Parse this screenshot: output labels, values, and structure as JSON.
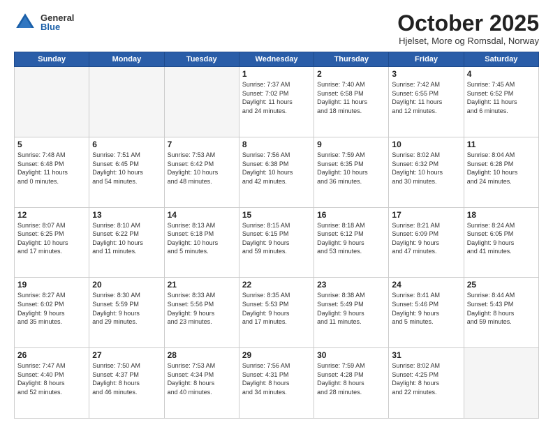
{
  "logo": {
    "general": "General",
    "blue": "Blue"
  },
  "title": "October 2025",
  "location": "Hjelset, More og Romsdal, Norway",
  "days_of_week": [
    "Sunday",
    "Monday",
    "Tuesday",
    "Wednesday",
    "Thursday",
    "Friday",
    "Saturday"
  ],
  "weeks": [
    [
      {
        "day": "",
        "info": ""
      },
      {
        "day": "",
        "info": ""
      },
      {
        "day": "",
        "info": ""
      },
      {
        "day": "1",
        "info": "Sunrise: 7:37 AM\nSunset: 7:02 PM\nDaylight: 11 hours\nand 24 minutes."
      },
      {
        "day": "2",
        "info": "Sunrise: 7:40 AM\nSunset: 6:58 PM\nDaylight: 11 hours\nand 18 minutes."
      },
      {
        "day": "3",
        "info": "Sunrise: 7:42 AM\nSunset: 6:55 PM\nDaylight: 11 hours\nand 12 minutes."
      },
      {
        "day": "4",
        "info": "Sunrise: 7:45 AM\nSunset: 6:52 PM\nDaylight: 11 hours\nand 6 minutes."
      }
    ],
    [
      {
        "day": "5",
        "info": "Sunrise: 7:48 AM\nSunset: 6:48 PM\nDaylight: 11 hours\nand 0 minutes."
      },
      {
        "day": "6",
        "info": "Sunrise: 7:51 AM\nSunset: 6:45 PM\nDaylight: 10 hours\nand 54 minutes."
      },
      {
        "day": "7",
        "info": "Sunrise: 7:53 AM\nSunset: 6:42 PM\nDaylight: 10 hours\nand 48 minutes."
      },
      {
        "day": "8",
        "info": "Sunrise: 7:56 AM\nSunset: 6:38 PM\nDaylight: 10 hours\nand 42 minutes."
      },
      {
        "day": "9",
        "info": "Sunrise: 7:59 AM\nSunset: 6:35 PM\nDaylight: 10 hours\nand 36 minutes."
      },
      {
        "day": "10",
        "info": "Sunrise: 8:02 AM\nSunset: 6:32 PM\nDaylight: 10 hours\nand 30 minutes."
      },
      {
        "day": "11",
        "info": "Sunrise: 8:04 AM\nSunset: 6:28 PM\nDaylight: 10 hours\nand 24 minutes."
      }
    ],
    [
      {
        "day": "12",
        "info": "Sunrise: 8:07 AM\nSunset: 6:25 PM\nDaylight: 10 hours\nand 17 minutes."
      },
      {
        "day": "13",
        "info": "Sunrise: 8:10 AM\nSunset: 6:22 PM\nDaylight: 10 hours\nand 11 minutes."
      },
      {
        "day": "14",
        "info": "Sunrise: 8:13 AM\nSunset: 6:18 PM\nDaylight: 10 hours\nand 5 minutes."
      },
      {
        "day": "15",
        "info": "Sunrise: 8:15 AM\nSunset: 6:15 PM\nDaylight: 9 hours\nand 59 minutes."
      },
      {
        "day": "16",
        "info": "Sunrise: 8:18 AM\nSunset: 6:12 PM\nDaylight: 9 hours\nand 53 minutes."
      },
      {
        "day": "17",
        "info": "Sunrise: 8:21 AM\nSunset: 6:09 PM\nDaylight: 9 hours\nand 47 minutes."
      },
      {
        "day": "18",
        "info": "Sunrise: 8:24 AM\nSunset: 6:05 PM\nDaylight: 9 hours\nand 41 minutes."
      }
    ],
    [
      {
        "day": "19",
        "info": "Sunrise: 8:27 AM\nSunset: 6:02 PM\nDaylight: 9 hours\nand 35 minutes."
      },
      {
        "day": "20",
        "info": "Sunrise: 8:30 AM\nSunset: 5:59 PM\nDaylight: 9 hours\nand 29 minutes."
      },
      {
        "day": "21",
        "info": "Sunrise: 8:33 AM\nSunset: 5:56 PM\nDaylight: 9 hours\nand 23 minutes."
      },
      {
        "day": "22",
        "info": "Sunrise: 8:35 AM\nSunset: 5:53 PM\nDaylight: 9 hours\nand 17 minutes."
      },
      {
        "day": "23",
        "info": "Sunrise: 8:38 AM\nSunset: 5:49 PM\nDaylight: 9 hours\nand 11 minutes."
      },
      {
        "day": "24",
        "info": "Sunrise: 8:41 AM\nSunset: 5:46 PM\nDaylight: 9 hours\nand 5 minutes."
      },
      {
        "day": "25",
        "info": "Sunrise: 8:44 AM\nSunset: 5:43 PM\nDaylight: 8 hours\nand 59 minutes."
      }
    ],
    [
      {
        "day": "26",
        "info": "Sunrise: 7:47 AM\nSunset: 4:40 PM\nDaylight: 8 hours\nand 52 minutes."
      },
      {
        "day": "27",
        "info": "Sunrise: 7:50 AM\nSunset: 4:37 PM\nDaylight: 8 hours\nand 46 minutes."
      },
      {
        "day": "28",
        "info": "Sunrise: 7:53 AM\nSunset: 4:34 PM\nDaylight: 8 hours\nand 40 minutes."
      },
      {
        "day": "29",
        "info": "Sunrise: 7:56 AM\nSunset: 4:31 PM\nDaylight: 8 hours\nand 34 minutes."
      },
      {
        "day": "30",
        "info": "Sunrise: 7:59 AM\nSunset: 4:28 PM\nDaylight: 8 hours\nand 28 minutes."
      },
      {
        "day": "31",
        "info": "Sunrise: 8:02 AM\nSunset: 4:25 PM\nDaylight: 8 hours\nand 22 minutes."
      },
      {
        "day": "",
        "info": ""
      }
    ]
  ]
}
